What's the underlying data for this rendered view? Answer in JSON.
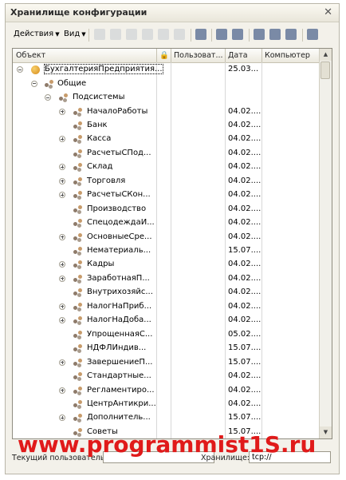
{
  "window": {
    "title": "Хранилище конфигурации"
  },
  "toolbar": {
    "actions_label": "Действия",
    "view_label": "Вид"
  },
  "columns": [
    "Объект",
    "Пользоват...",
    "Дата",
    "Компьютер"
  ],
  "tree": {
    "root": {
      "label": "БухгалтерияПредприятия...",
      "date": "25.03..."
    },
    "common": {
      "label": "Общие"
    },
    "subsystems": {
      "label": "Подсистемы"
    },
    "items": [
      {
        "label": "НачалоРаботы",
        "date": "04.02....",
        "expand": true
      },
      {
        "label": "Банк",
        "date": "04.02....",
        "expand": false
      },
      {
        "label": "Касса",
        "date": "04.02....",
        "expand": true
      },
      {
        "label": "РасчетыСПод...",
        "date": "04.02....",
        "expand": false
      },
      {
        "label": "Склад",
        "date": "04.02....",
        "expand": true
      },
      {
        "label": "Торговля",
        "date": "04.02....",
        "expand": true
      },
      {
        "label": "РасчетыСКон...",
        "date": "04.02....",
        "expand": true
      },
      {
        "label": "Производство",
        "date": "04.02....",
        "expand": false
      },
      {
        "label": "СпецодеждаИ...",
        "date": "04.02....",
        "expand": false
      },
      {
        "label": "ОсновныеСре...",
        "date": "04.02....",
        "expand": true
      },
      {
        "label": "Нематериаль...",
        "date": "15.07....",
        "expand": false
      },
      {
        "label": "Кадры",
        "date": "04.02....",
        "expand": true
      },
      {
        "label": "ЗаработнаяП...",
        "date": "04.02....",
        "expand": true
      },
      {
        "label": "Внутрихозяйс...",
        "date": "04.02....",
        "expand": false
      },
      {
        "label": "НалогНаПриб...",
        "date": "04.02....",
        "expand": true
      },
      {
        "label": "НалогНаДоба...",
        "date": "04.02....",
        "expand": true
      },
      {
        "label": "УпрощеннаяС...",
        "date": "05.02....",
        "expand": false
      },
      {
        "label": "НДФЛИндив...",
        "date": "15.07....",
        "expand": false
      },
      {
        "label": "ЗавершениеП...",
        "date": "15.07....",
        "expand": true
      },
      {
        "label": "Стандартные...",
        "date": "04.02....",
        "expand": false
      },
      {
        "label": "Регламентиро...",
        "date": "04.02....",
        "expand": true
      },
      {
        "label": "ЦентрАнтикри...",
        "date": "04.02....",
        "expand": false
      },
      {
        "label": "Дополнитель...",
        "date": "15.07....",
        "expand": true
      },
      {
        "label": "Советы",
        "date": "15.07....",
        "expand": false
      }
    ]
  },
  "status": {
    "user_label": "Текущий пользователь:",
    "user_value": "",
    "storage_label": "Хранилище:",
    "storage_value": "tcp://"
  },
  "watermark": "www.programmist1S.ru"
}
